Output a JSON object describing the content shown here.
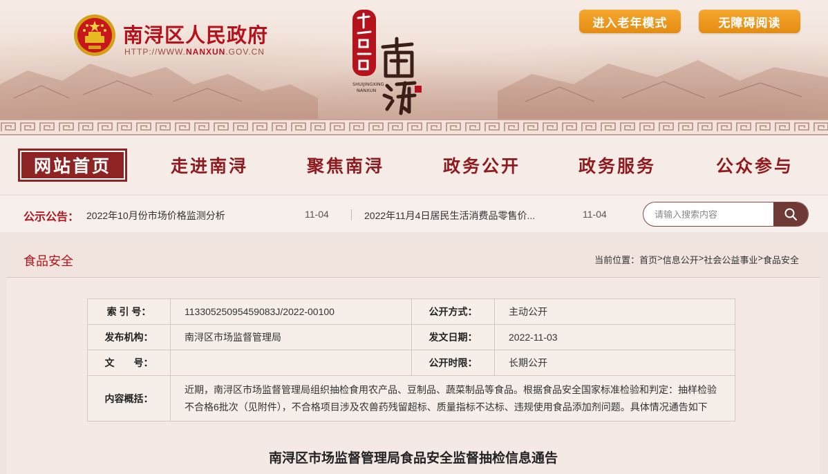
{
  "header": {
    "site_name": "南浔区人民政府",
    "url_prefix": "HTTP://WWW.",
    "url_domain": "NANXUN",
    "url_suffix": ".GOV.CN",
    "logo_brand_en_1": "SHUIJINGXING",
    "logo_brand_en_2": "NANXUN",
    "elder_mode_label": "进入老年模式",
    "accessible_label": "无障碍阅读"
  },
  "nav": {
    "items": [
      {
        "label": "网站首页",
        "active": true
      },
      {
        "label": "走进南浔",
        "active": false
      },
      {
        "label": "聚焦南浔",
        "active": false
      },
      {
        "label": "政务公开",
        "active": false
      },
      {
        "label": "政务服务",
        "active": false
      },
      {
        "label": "公众参与",
        "active": false
      }
    ]
  },
  "notice": {
    "label": "公示公告：",
    "items": [
      {
        "title": "2022年10月份市场价格监测分析",
        "date": "11-04"
      },
      {
        "title": "2022年11月4日居民生活消费品零售价...",
        "date": "11-04"
      }
    ]
  },
  "search": {
    "placeholder": "请输入搜索内容"
  },
  "panel": {
    "title": "食品安全",
    "breadcrumb": {
      "prefix": "当前位置：",
      "items": [
        "首页",
        "信息公开",
        "社会公益事业",
        "食品安全"
      ],
      "separator": " > "
    }
  },
  "meta": {
    "index_key": "索 引 号：",
    "index_value": "11330525095459083J/2022-00100",
    "open_mode_key": "公开方式：",
    "open_mode_value": "主动公开",
    "publisher_key": "发布机构：",
    "publisher_value": "南浔区市场监督管理局",
    "date_key": "发文日期：",
    "date_value": "2022-11-03",
    "doc_no_key": "文　　号：",
    "doc_no_value": "",
    "open_period_key": "公开时限：",
    "open_period_value": "长期公开",
    "summary_key": "内容概括：",
    "summary_value": "近期，南浔区市场监督管理局组织抽检食用农产品、豆制品、蔬菜制品等食品。根据食品安全国家标准检验和判定：抽样检验不合格6批次（见附件），不合格项目涉及农兽药残留超标、质量指标不达标、违规使用食品添加剂问题。具体情况通告如下"
  },
  "article": {
    "title": "南浔区市场监督管理局食品安全监督抽检信息通告"
  },
  "colors": {
    "brand_red": "#b5121b",
    "nav_red": "#8f1b1f",
    "active_bg": "#8e2323",
    "orange_button": "#f6a72e",
    "search_button": "#6f3a35"
  }
}
